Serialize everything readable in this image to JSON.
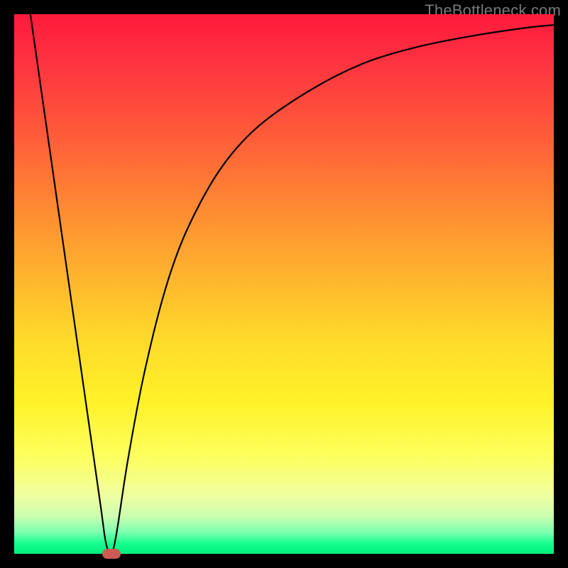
{
  "watermark": {
    "text": "TheBottleneck.com"
  },
  "colors": {
    "frame": "#000000",
    "gradient_top": "#ff1a3c",
    "gradient_bottom": "#00f07e",
    "curve": "#000000",
    "marker": "#cc5a55",
    "watermark": "#7a7a7a"
  },
  "chart_data": {
    "type": "line",
    "title": "",
    "xlabel": "",
    "ylabel": "",
    "xlim": [
      0,
      100
    ],
    "ylim": [
      0,
      100
    ],
    "grid": false,
    "legend": false,
    "note": "y is bottleneck percentage; 0 = optimal (bottom/green), 100 = worst (top/red). Values estimated from pixel positions.",
    "series": [
      {
        "name": "bottleneck-curve",
        "x": [
          3,
          5,
          8,
          10,
          12,
          14,
          16,
          17,
          18,
          19,
          21,
          24,
          28,
          32,
          38,
          45,
          55,
          65,
          75,
          85,
          95,
          100
        ],
        "y": [
          100,
          86,
          65,
          51,
          37,
          23,
          9,
          2,
          0,
          4,
          17,
          33,
          49,
          60,
          71,
          79,
          86,
          91,
          94,
          96,
          97.5,
          98
        ]
      }
    ],
    "marker": {
      "x": 18,
      "y": 0,
      "label": "optimal-point"
    }
  }
}
